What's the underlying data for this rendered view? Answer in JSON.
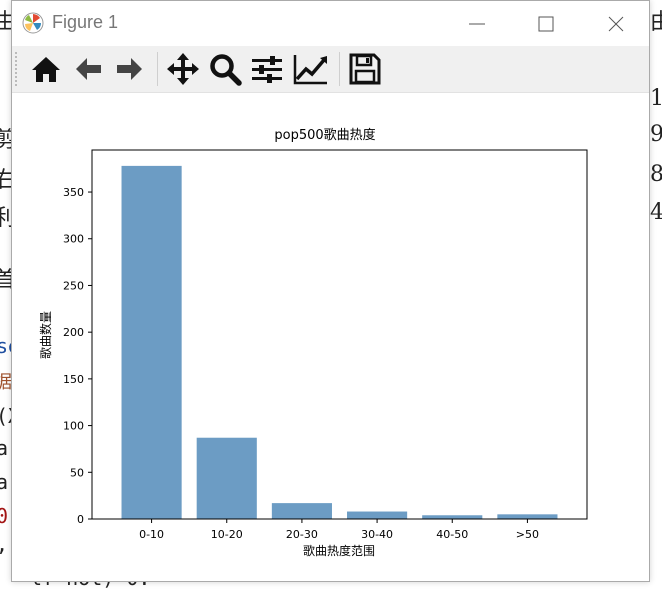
{
  "window": {
    "title": "Figure 1",
    "minimize_label": "—",
    "maximize_label": "☐",
    "close_label": "✕"
  },
  "toolbar": {
    "tools": [
      {
        "name": "home-icon"
      },
      {
        "name": "back-arrow-icon"
      },
      {
        "name": "forward-arrow-icon"
      },
      {
        "name": "pan-move-icon"
      },
      {
        "name": "zoom-magnifier-icon"
      },
      {
        "name": "configure-subplots-icon"
      },
      {
        "name": "edit-axis-icon"
      },
      {
        "name": "save-floppy-icon"
      }
    ]
  },
  "background": {
    "left_glyphs": [
      "由",
      "剪",
      "右",
      "利",
      "首",
      "se",
      "据",
      "(X",
      "ar",
      "ar",
      "0",
      ",",
      "lf"
    ],
    "right_glyphs": [
      "由",
      "1",
      "9",
      "8",
      "4"
    ],
    "bottom_code": "lf  hot)     0:"
  },
  "chart_data": {
    "type": "bar",
    "title": "pop500歌曲热度",
    "xlabel": "歌曲热度范围",
    "ylabel": "歌曲数量",
    "categories": [
      "0-10",
      "10-20",
      "20-30",
      "30-40",
      "40-50",
      ">50"
    ],
    "values": [
      378,
      87,
      17,
      8,
      4,
      5
    ],
    "ylim": [
      0,
      395
    ],
    "yticks": [
      0,
      50,
      100,
      150,
      200,
      250,
      300,
      350
    ],
    "bar_color": "#6c9cc4",
    "grid": false
  }
}
